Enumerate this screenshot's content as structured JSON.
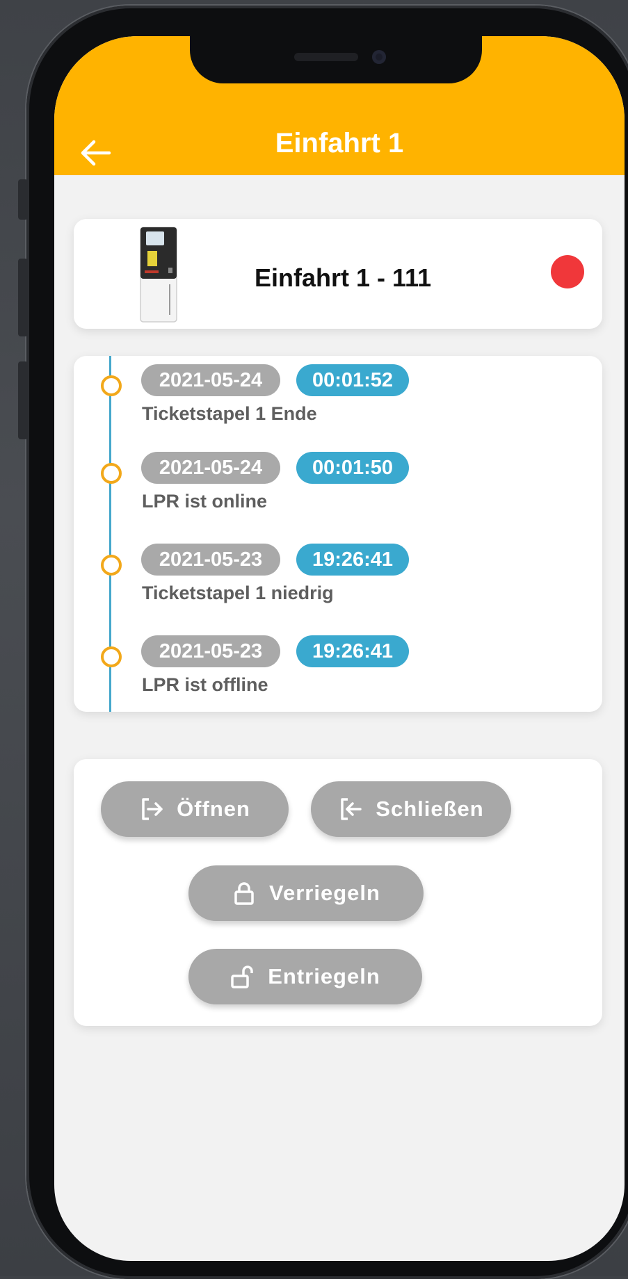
{
  "header": {
    "title": "Einfahrt 1",
    "background": "#ffb300"
  },
  "device": {
    "name": "Einfahrt 1 - 111",
    "image": "ticket-machine-image",
    "status_color": "#f0373a"
  },
  "timeline": {
    "line_color": "#46a8cc",
    "dot_color": "#f2a81a",
    "events": [
      {
        "date": "2021-05-24",
        "time": "00:01:52",
        "message": "Ticketstapel 1 Ende"
      },
      {
        "date": "2021-05-24",
        "time": "00:01:50",
        "message": "LPR ist online"
      },
      {
        "date": "2021-05-23",
        "time": "19:26:41",
        "message": "Ticketstapel 1 niedrig"
      },
      {
        "date": "2021-05-23",
        "time": "19:26:41",
        "message": "LPR ist offline"
      }
    ]
  },
  "actions": {
    "open_label": "Öffnen",
    "close_label": "Schließen",
    "lock_label": "Verriegeln",
    "unlock_label": "Entriegeln"
  },
  "colors": {
    "date_pill": "#a9a9a9",
    "time_pill": "#3aa9cf",
    "button": "#a8a8a8"
  }
}
